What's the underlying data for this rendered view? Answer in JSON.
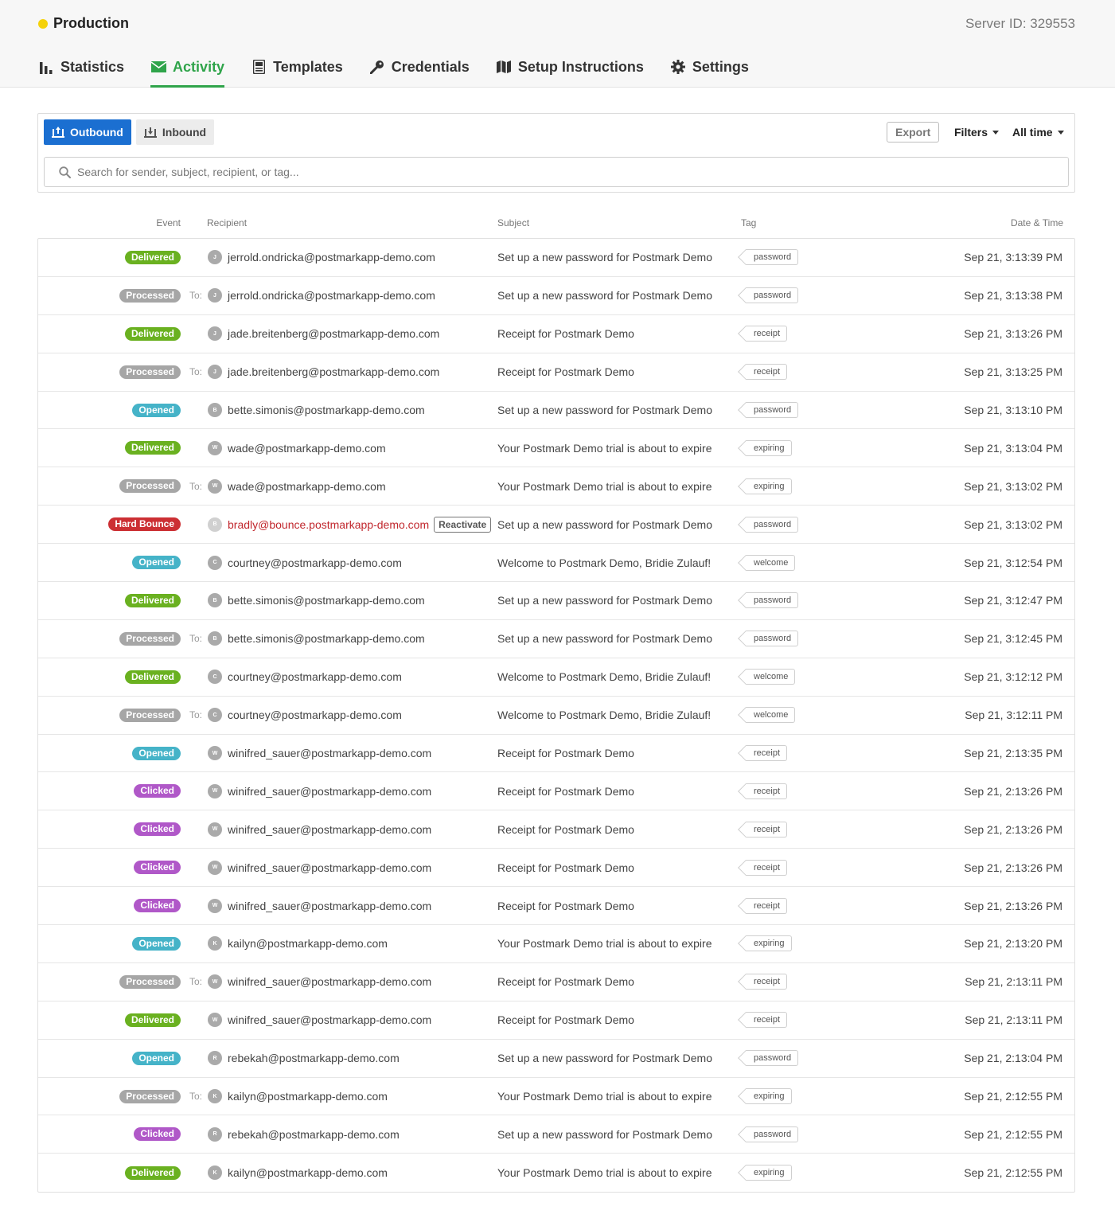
{
  "server": {
    "name": "Production",
    "status_color": "#f5d20a",
    "server_id": "Server ID: 329553"
  },
  "nav": {
    "tabs": [
      {
        "label": "Statistics",
        "icon": "bar-chart-icon",
        "active": false
      },
      {
        "label": "Activity",
        "icon": "envelope-icon",
        "active": true
      },
      {
        "label": "Templates",
        "icon": "template-icon",
        "active": false
      },
      {
        "label": "Credentials",
        "icon": "key-icon",
        "active": false
      },
      {
        "label": "Setup Instructions",
        "icon": "map-icon",
        "active": false
      },
      {
        "label": "Settings",
        "icon": "gear-icon",
        "active": false
      }
    ]
  },
  "toolbar": {
    "outbound_label": "Outbound",
    "inbound_label": "Inbound",
    "export_label": "Export",
    "filters_label": "Filters",
    "timerange_label": "All time"
  },
  "search": {
    "placeholder": "Search for sender, subject, recipient, or tag...",
    "value": ""
  },
  "table": {
    "headers": {
      "event": "Event",
      "recipient": "Recipient",
      "subject": "Subject",
      "tag": "Tag",
      "date": "Date & Time"
    },
    "to_label": "To:",
    "reactivate_label": "Reactivate",
    "rows": [
      {
        "event": "Delivered",
        "to": false,
        "initial": "J",
        "recipient": "jerrold.ondricka@postmarkapp-demo.com",
        "subject": "Set up a new password for Postmark Demo",
        "tag": "password",
        "date": "Sep 21, 3:13:39 PM"
      },
      {
        "event": "Processed",
        "to": true,
        "initial": "J",
        "recipient": "jerrold.ondricka@postmarkapp-demo.com",
        "subject": "Set up a new password for Postmark Demo",
        "tag": "password",
        "date": "Sep 21, 3:13:38 PM"
      },
      {
        "event": "Delivered",
        "to": false,
        "initial": "J",
        "recipient": "jade.breitenberg@postmarkapp-demo.com",
        "subject": "Receipt for Postmark Demo",
        "tag": "receipt",
        "date": "Sep 21, 3:13:26 PM"
      },
      {
        "event": "Processed",
        "to": true,
        "initial": "J",
        "recipient": "jade.breitenberg@postmarkapp-demo.com",
        "subject": "Receipt for Postmark Demo",
        "tag": "receipt",
        "date": "Sep 21, 3:13:25 PM"
      },
      {
        "event": "Opened",
        "to": false,
        "initial": "B",
        "recipient": "bette.simonis@postmarkapp-demo.com",
        "subject": "Set up a new password for Postmark Demo",
        "tag": "password",
        "date": "Sep 21, 3:13:10 PM"
      },
      {
        "event": "Delivered",
        "to": false,
        "initial": "W",
        "recipient": "wade@postmarkapp-demo.com",
        "subject": "Your Postmark Demo trial is about to expire",
        "tag": "expiring",
        "date": "Sep 21, 3:13:04 PM"
      },
      {
        "event": "Processed",
        "to": true,
        "initial": "W",
        "recipient": "wade@postmarkapp-demo.com",
        "subject": "Your Postmark Demo trial is about to expire",
        "tag": "expiring",
        "date": "Sep 21, 3:13:02 PM"
      },
      {
        "event": "Hard Bounce",
        "to": false,
        "initial": "B",
        "recipient": "bradly@bounce.postmarkapp-demo.com",
        "bounce": true,
        "subject": "Set up a new password for Postmark Demo",
        "tag": "password",
        "date": "Sep 21, 3:13:02 PM"
      },
      {
        "event": "Opened",
        "to": false,
        "initial": "C",
        "recipient": "courtney@postmarkapp-demo.com",
        "subject": "Welcome to Postmark Demo, Bridie Zulauf!",
        "tag": "welcome",
        "date": "Sep 21, 3:12:54 PM"
      },
      {
        "event": "Delivered",
        "to": false,
        "initial": "B",
        "recipient": "bette.simonis@postmarkapp-demo.com",
        "subject": "Set up a new password for Postmark Demo",
        "tag": "password",
        "date": "Sep 21, 3:12:47 PM"
      },
      {
        "event": "Processed",
        "to": true,
        "initial": "B",
        "recipient": "bette.simonis@postmarkapp-demo.com",
        "subject": "Set up a new password for Postmark Demo",
        "tag": "password",
        "date": "Sep 21, 3:12:45 PM"
      },
      {
        "event": "Delivered",
        "to": false,
        "initial": "C",
        "recipient": "courtney@postmarkapp-demo.com",
        "subject": "Welcome to Postmark Demo, Bridie Zulauf!",
        "tag": "welcome",
        "date": "Sep 21, 3:12:12 PM"
      },
      {
        "event": "Processed",
        "to": true,
        "initial": "C",
        "recipient": "courtney@postmarkapp-demo.com",
        "subject": "Welcome to Postmark Demo, Bridie Zulauf!",
        "tag": "welcome",
        "date": "Sep 21, 3:12:11 PM"
      },
      {
        "event": "Opened",
        "to": false,
        "initial": "W",
        "recipient": "winifred_sauer@postmarkapp-demo.com",
        "subject": "Receipt for Postmark Demo",
        "tag": "receipt",
        "date": "Sep 21, 2:13:35 PM"
      },
      {
        "event": "Clicked",
        "to": false,
        "initial": "W",
        "recipient": "winifred_sauer@postmarkapp-demo.com",
        "subject": "Receipt for Postmark Demo",
        "tag": "receipt",
        "date": "Sep 21, 2:13:26 PM"
      },
      {
        "event": "Clicked",
        "to": false,
        "initial": "W",
        "recipient": "winifred_sauer@postmarkapp-demo.com",
        "subject": "Receipt for Postmark Demo",
        "tag": "receipt",
        "date": "Sep 21, 2:13:26 PM"
      },
      {
        "event": "Clicked",
        "to": false,
        "initial": "W",
        "recipient": "winifred_sauer@postmarkapp-demo.com",
        "subject": "Receipt for Postmark Demo",
        "tag": "receipt",
        "date": "Sep 21, 2:13:26 PM"
      },
      {
        "event": "Clicked",
        "to": false,
        "initial": "W",
        "recipient": "winifred_sauer@postmarkapp-demo.com",
        "subject": "Receipt for Postmark Demo",
        "tag": "receipt",
        "date": "Sep 21, 2:13:26 PM"
      },
      {
        "event": "Opened",
        "to": false,
        "initial": "K",
        "recipient": "kailyn@postmarkapp-demo.com",
        "subject": "Your Postmark Demo trial is about to expire",
        "tag": "expiring",
        "date": "Sep 21, 2:13:20 PM"
      },
      {
        "event": "Processed",
        "to": true,
        "initial": "W",
        "recipient": "winifred_sauer@postmarkapp-demo.com",
        "subject": "Receipt for Postmark Demo",
        "tag": "receipt",
        "date": "Sep 21, 2:13:11 PM"
      },
      {
        "event": "Delivered",
        "to": false,
        "initial": "W",
        "recipient": "winifred_sauer@postmarkapp-demo.com",
        "subject": "Receipt for Postmark Demo",
        "tag": "receipt",
        "date": "Sep 21, 2:13:11 PM"
      },
      {
        "event": "Opened",
        "to": false,
        "initial": "R",
        "recipient": "rebekah@postmarkapp-demo.com",
        "subject": "Set up a new password for Postmark Demo",
        "tag": "password",
        "date": "Sep 21, 2:13:04 PM"
      },
      {
        "event": "Processed",
        "to": true,
        "initial": "K",
        "recipient": "kailyn@postmarkapp-demo.com",
        "subject": "Your Postmark Demo trial is about to expire",
        "tag": "expiring",
        "date": "Sep 21, 2:12:55 PM"
      },
      {
        "event": "Clicked",
        "to": false,
        "initial": "R",
        "recipient": "rebekah@postmarkapp-demo.com",
        "subject": "Set up a new password for Postmark Demo",
        "tag": "password",
        "date": "Sep 21, 2:12:55 PM"
      },
      {
        "event": "Delivered",
        "to": false,
        "initial": "K",
        "recipient": "kailyn@postmarkapp-demo.com",
        "subject": "Your Postmark Demo trial is about to expire",
        "tag": "expiring",
        "date": "Sep 21, 2:12:55 PM"
      }
    ]
  },
  "event_colors": {
    "Delivered": "#6ab120",
    "Processed": "#a6a6a6",
    "Opened": "#45b3c8",
    "Clicked": "#b058c8",
    "Hard Bounce": "#cc2f33"
  },
  "accent_color": "#2fa44a",
  "primary_color": "#1b6fd1"
}
